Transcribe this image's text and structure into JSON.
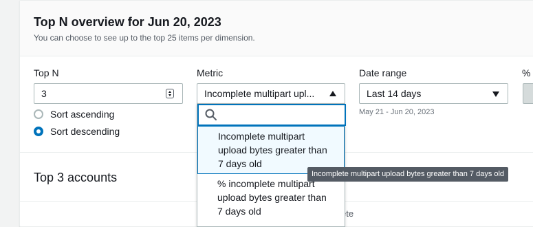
{
  "header": {
    "title": "Top N overview for Jun 20, 2023",
    "subtitle": "You can choose to see up to the top 25 items per dimension."
  },
  "top_n": {
    "label": "Top N",
    "value": "3",
    "sort_options": [
      {
        "label": "Sort ascending",
        "checked": false
      },
      {
        "label": "Sort descending",
        "checked": true
      }
    ]
  },
  "metric": {
    "label": "Metric",
    "selected": "Incomplete multipart upl...",
    "search_placeholder": "",
    "options": [
      {
        "lines": [
          "Incomplete multipart",
          "upload bytes greater than",
          "7 days old"
        ],
        "highlighted": true
      },
      {
        "lines": [
          "% incomplete multipart",
          "upload bytes greater than",
          "7 days old"
        ],
        "highlighted": false
      }
    ],
    "tooltip": "Incomplete multipart upload bytes greater than 7 days old"
  },
  "date_range": {
    "label": "Date range",
    "selected": "Last 14 days",
    "hint": "May 21 - Jun 20, 2023"
  },
  "percent_column": {
    "label": "%"
  },
  "section": {
    "title": "Top 3 accounts",
    "partial_text": "ete"
  },
  "colors": {
    "accent": "#0073bb",
    "border": "#aab7b8",
    "tooltip_bg": "#545b64"
  }
}
